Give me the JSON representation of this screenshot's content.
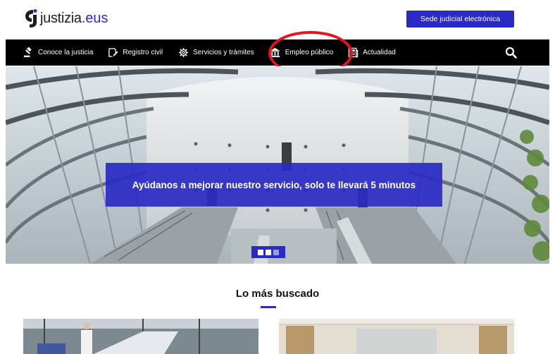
{
  "header": {
    "logo_text": "justizia",
    "logo_suffix": ".eus",
    "sede_button": "Sede judicial electrónica"
  },
  "nav": {
    "items": [
      {
        "label": "Conoce la justicia",
        "icon": "gavel-icon"
      },
      {
        "label": "Registro civil",
        "icon": "document-pen-icon"
      },
      {
        "label": "Servicios y trámites",
        "icon": "gear-icon"
      },
      {
        "label": "Empleo público",
        "icon": "building-icon"
      },
      {
        "label": "Actualidad",
        "icon": "newspaper-icon"
      }
    ],
    "search_icon": "search-icon"
  },
  "hero": {
    "banner_text": "Ayúdanos a mejorar nuestro servicio, solo te llevará 5 minutos",
    "slides_total": 3,
    "active_slide": 1
  },
  "section": {
    "title": "Lo más buscado"
  },
  "colors": {
    "brand_blue": "#2a2ac4",
    "nav_bg": "#000000",
    "highlight_red": "#e8141b"
  }
}
